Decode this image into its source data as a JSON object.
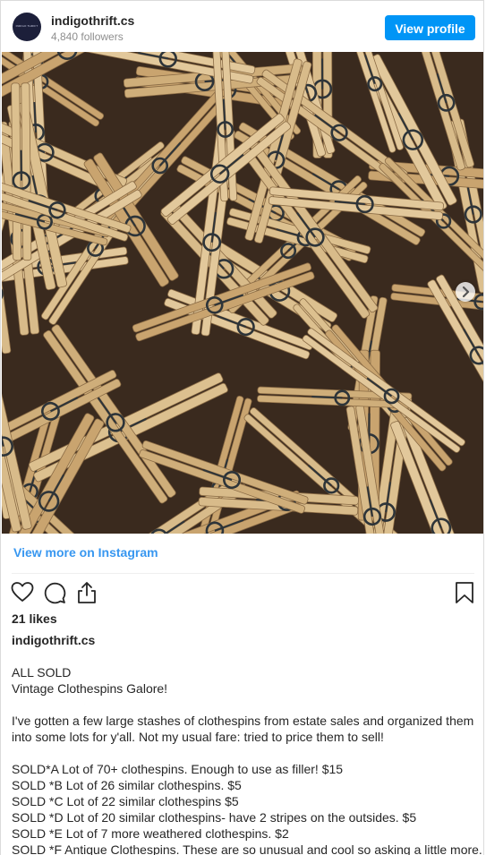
{
  "header": {
    "username": "indigothrift.cs",
    "followers": "4,840 followers",
    "avatar_text": "INDIGO THRIFT",
    "view_profile": "View profile"
  },
  "photo": {
    "subject": "clothespins-photo",
    "wood_color": "#d8bb8a",
    "table_color": "#3a2a1e",
    "spring_color": "#2d3439"
  },
  "view_more": "View more on Instagram",
  "icons": [
    "heart-icon",
    "comment-icon",
    "share-icon",
    "bookmark-icon",
    "chevron-right-icon"
  ],
  "likes": "21 likes",
  "caption": {
    "username": "indigothrift.cs",
    "lines": [
      "ALL SOLD",
      "Vintage Clothespins Galore!",
      "",
      "I've gotten a few large stashes of clothespins from estate sales and organized them into some lots for y'all. Not my usual fare: tried to price them to sell!",
      "",
      "SOLD*A Lot of 70+ clothespins. Enough to use as filler! $15",
      "SOLD *B Lot of 26 similar clothespins. $5",
      "SOLD *C Lot of 22 similar clothespins $5",
      "SOLD *D Lot of 20 similar clothespins- have 2 stripes on the outsides. $5",
      "SOLD *E Lot of 7 more weathered clothespins. $2",
      "SOLD *F Antique Clothespins. These are so unusual and cool so asking a little more."
    ]
  }
}
